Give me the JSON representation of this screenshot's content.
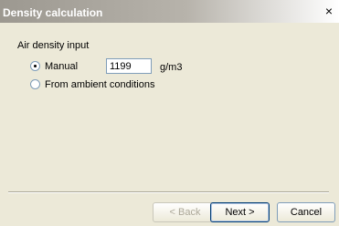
{
  "window": {
    "title": "Density calculation",
    "close_glyph": "×"
  },
  "group": {
    "label": "Air density input"
  },
  "options": {
    "manual_label": "Manual",
    "manual_selected": true,
    "ambient_label": "From ambient conditions",
    "ambient_selected": false
  },
  "density_input": {
    "value": "1199",
    "unit": "g/m3"
  },
  "buttons": {
    "back_label": "< Back",
    "back_enabled": false,
    "next_label": "Next >",
    "cancel_label": "Cancel"
  },
  "colors": {
    "title_gradient_start": "#9c9890",
    "dialog_background": "#ece9d8",
    "input_border": "#7f9db9",
    "disabled_text": "#aca899"
  }
}
